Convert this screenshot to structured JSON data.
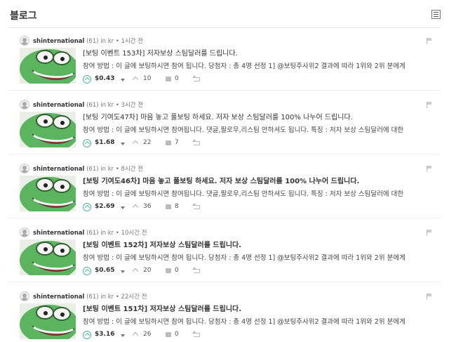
{
  "header": {
    "title": "블로그"
  },
  "icons": {
    "avatar": "user-avatar-icon",
    "thumbnail": "smiling-frog-image",
    "flag": "flag-icon",
    "upvote": "upvote-chevron-icon",
    "payout_dropdown": "caret-down-icon",
    "voters": "voters-chevron-icon",
    "comments": "comment-bubble-icon",
    "resteem": "resteem-icon",
    "list_toggle": "list-view-toggle-icon"
  },
  "colors": {
    "accent_green": "#48b98f",
    "text_dark": "#333333",
    "muted": "#777777",
    "frog_green": "#5bb55e",
    "frog_mouth": "#a33b2c"
  },
  "posts": [
    {
      "author": "shinternational",
      "reputation": "(61)",
      "meta": "in kr • 1시간 전",
      "title": "[보팅 이벤트 153차] 저자보상 스팀달러를 드립니다.",
      "bold_title": false,
      "excerpt": "참여 방법 : 이 글에 보팅하시면 참여 됩니다. 당첨자 : 총 4명 선정 1] @보팅주사위2 결과에 따라 1위와 2위 분에게",
      "payout": "$0.43",
      "votes": "10",
      "comments": "0"
    },
    {
      "author": "shinternational",
      "reputation": "(61)",
      "meta": "in kr • 3시간 전",
      "title": "[보팅 기여도47차] 마음 놓고 풀보팅 하세요. 저자 보상 스팀달러를 100% 나누어 드립니다.",
      "bold_title": false,
      "excerpt": "참여 방법 : 이 글에 보팅하시면 참여됩니다. 댓글,팔로우,리스팀 안하셔도 됩니다. 특징 : 저자 보상 스팀달러에 대한",
      "payout": "$1.68",
      "votes": "22",
      "comments": "7"
    },
    {
      "author": "shinternational",
      "reputation": "(61)",
      "meta": "in kr • 8시간 전",
      "title": "[보팅 기여도46차] 마음 놓고 풀보팅 하세요. 저자 보상 스팀달러를 100% 나누어 드립니다.",
      "bold_title": true,
      "excerpt": "참여 방법 : 이 글에 보팅하시면 참여됩니다. 댓글,팔로우,리스팀 안하셔도 됩니다. 특징 : 저자 보상 스팀달러에 대한",
      "payout": "$2.69",
      "votes": "36",
      "comments": "8"
    },
    {
      "author": "shinternational",
      "reputation": "(61)",
      "meta": "in kr • 10시간 전",
      "title": "[보팅 이벤트 152차] 저자보상 스팀달러를 드립니다.",
      "bold_title": true,
      "excerpt": "참여 방법 : 이 글에 보팅하시면 참여 됩니다. 당첨자 : 총 4명 선정 1] @보팅주사위2 결과에 따라 1위와 2위 분에게",
      "payout": "$0.65",
      "votes": "20",
      "comments": "0"
    },
    {
      "author": "shinternational",
      "reputation": "(61)",
      "meta": "in kr • 22시간 전",
      "title": "[보팅 이벤트 151차] 저자보상 스팀달러를 드립니다.",
      "bold_title": true,
      "excerpt": "참여 방법 : 이 글에 보팅하시면 참여 됩니다. 당첨자 : 총 4명 선정 1] @보팅주사위2 결과에 따라 1위와 2위 분에게",
      "payout": "$3.16",
      "votes": "26",
      "comments": "0"
    }
  ]
}
